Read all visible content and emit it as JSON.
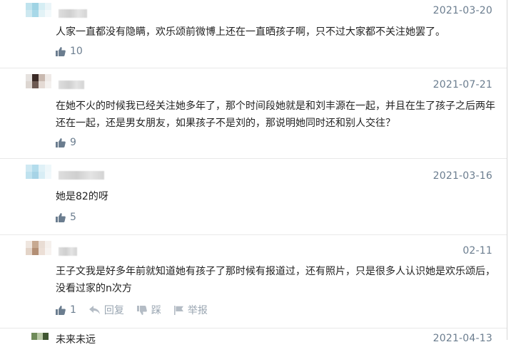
{
  "icons": {
    "like": "thumbs-up-icon",
    "reply": "reply-icon",
    "dislike": "thumbs-down-icon",
    "report": "flag-icon"
  },
  "colors": {
    "meta": "#6b7d8f",
    "text": "#222222",
    "muted": "#9aa6b2"
  },
  "comments": [
    {
      "date": "2021-03-20",
      "text": "人家一直都没有隐瞒，欢乐颂前微博上还在一直晒孩子啊，只不过大家都不关注她罢了。",
      "likes": "10"
    },
    {
      "date": "2021-07-21",
      "text": "在她不火的时候我已经关注她多年了，那个时间段她就是和刘丰源在一起，并且在生了孩子之后两年还在一起，还是男女朋友，如果孩子不是刘的，那说明她同时还和别人交往？",
      "likes": "9"
    },
    {
      "date": "2021-03-16",
      "text": "她是82的呀",
      "likes": "5"
    },
    {
      "date": "02-11",
      "text": "王子文我是好多年前就知道她有孩子了那时候有报道过，还有照片，只是很多人认识她是欢乐颂后，没看过家的n次方",
      "likes": "1",
      "reply_label": "回复",
      "dislike_label": "踩",
      "report_label": "举报"
    },
    {
      "date": "2021-04-13",
      "username": "未来未远"
    }
  ]
}
